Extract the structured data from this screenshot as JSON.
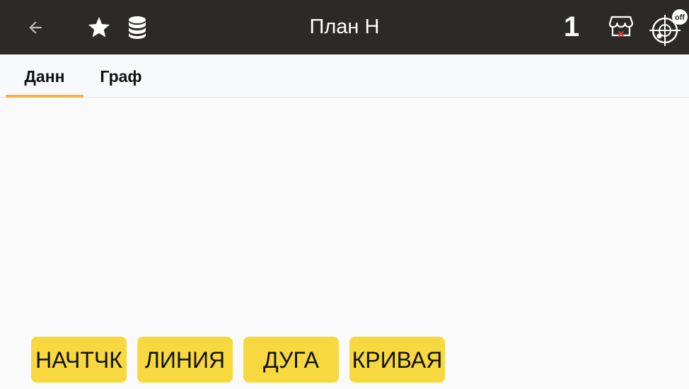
{
  "app_bar": {
    "title": "План Н",
    "counter": "1",
    "gps_badge": "off",
    "icons": {
      "back": "arrow-back-icon",
      "favorite": "star-icon",
      "database": "database-icon",
      "store": "store-icon",
      "gps": "gps-crosshair-icon"
    }
  },
  "tabs": [
    {
      "label": "Данн",
      "active": true
    },
    {
      "label": "Граф",
      "active": false
    }
  ],
  "actions": [
    {
      "label": "НАЧТЧК"
    },
    {
      "label": "ЛИНИЯ"
    },
    {
      "label": "ДУГА"
    },
    {
      "label": "КРИВАЯ"
    }
  ],
  "colors": {
    "app_bar_bg": "#2b2a28",
    "tab_indicator": "#f5b342",
    "action_button_bg": "#f7d93f",
    "content_bg": "#fafafa",
    "store_x_mark": "#e53935"
  }
}
